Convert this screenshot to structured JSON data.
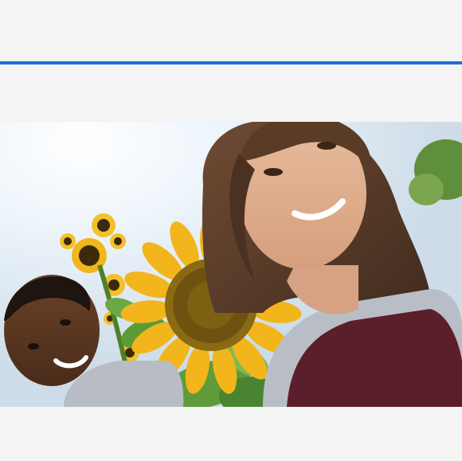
{
  "progress": {
    "value": 1.0,
    "color": "#1f6fd1"
  },
  "photo": {
    "icon": "photo-image",
    "subject": "selfie-in-sunflower-field"
  },
  "colors": {
    "background": "#f4f4f5",
    "sky": "#dfe9f2",
    "sunflower_petal": "#f2b51c",
    "sunflower_center": "#7a5b12",
    "leaf": "#4f8d2e",
    "sweater_maroon": "#5b1f2c",
    "cardigan_gray": "#b9bec6"
  }
}
